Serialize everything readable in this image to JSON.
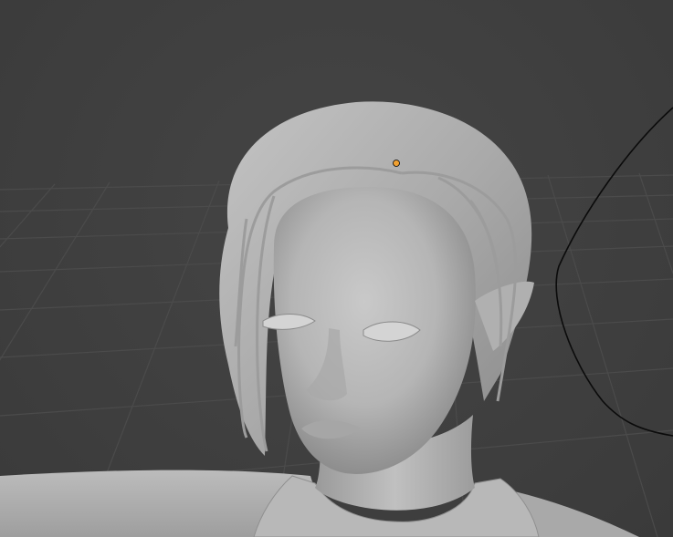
{
  "viewport": {
    "mode": "solid-shading",
    "background_color": "#3d3d3d",
    "grid_line_color": "#4a4a4a",
    "model_color": "#bdbdbd",
    "curve_color": "#000000",
    "selected_vertex_color": "#f0a030"
  },
  "scene": {
    "objects": [
      {
        "name": "body-mesh",
        "kind": "mesh"
      },
      {
        "name": "hair-mesh",
        "kind": "mesh"
      },
      {
        "name": "bezier-curve",
        "kind": "curve"
      }
    ],
    "selected_icon": "origin-point-icon"
  }
}
